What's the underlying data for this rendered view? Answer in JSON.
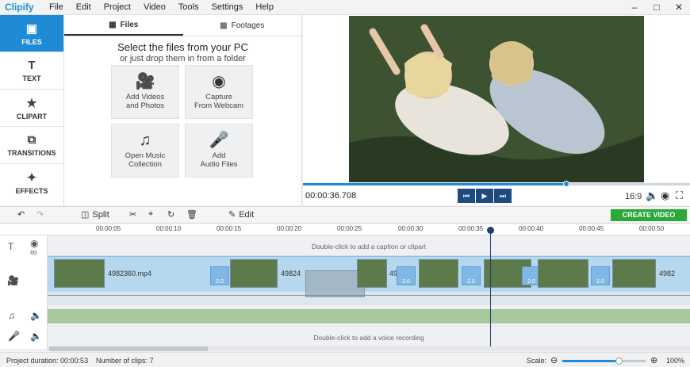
{
  "app": {
    "name": "Clipify"
  },
  "menu": [
    "File",
    "Edit",
    "Project",
    "Video",
    "Tools",
    "Settings",
    "Help"
  ],
  "sidebar": [
    {
      "label": "FILES",
      "icon": "folder-icon",
      "active": true
    },
    {
      "label": "TEXT",
      "icon": "text-icon",
      "active": false
    },
    {
      "label": "CLIPART",
      "icon": "star-icon",
      "active": false
    },
    {
      "label": "TRANSITIONS",
      "icon": "transitions-icon",
      "active": false
    },
    {
      "label": "EFFECTS",
      "icon": "magic-wand-icon",
      "active": false
    }
  ],
  "panel": {
    "tabs": [
      "Files",
      "Footages"
    ],
    "title": "Select the files from your PC",
    "subtitle": "or just drop them in from a folder",
    "tiles": [
      {
        "label1": "Add Videos",
        "label2": "and Photos",
        "icon": "film-camera-icon"
      },
      {
        "label1": "Capture",
        "label2": "From Webcam",
        "icon": "webcam-icon"
      },
      {
        "label1": "Open Music",
        "label2": "Collection",
        "icon": "music-notes-icon"
      },
      {
        "label1": "Add",
        "label2": "Audio Files",
        "icon": "microphone-icon"
      }
    ]
  },
  "preview": {
    "timecode": "00:00:36.708",
    "ratio": "16:9",
    "progress": 0.68
  },
  "toolbar": {
    "split": "Split",
    "edit": "Edit",
    "create": "CREATE VIDEO"
  },
  "ruler": [
    "00:00:05",
    "00:00:10",
    "00:00:15",
    "00:00:20",
    "00:00:25",
    "00:00:30",
    "00:00:35",
    "00:00:40",
    "00:00:45",
    "00:00:50"
  ],
  "timeline": {
    "caption_hint": "Double-click to add a caption or clipart",
    "voice_hint": "Double-click to add a voice recording",
    "clips": [
      {
        "name": "4982360.mp4"
      },
      {
        "name": "49824"
      },
      {
        "name": "49"
      },
      {
        "name": "4982"
      }
    ],
    "transition_label": "2.0"
  },
  "status": {
    "duration": "Project duration: 00:00:53",
    "clips": "Number of clips: 7",
    "scale_label": "Scale:",
    "zoom": "100%",
    "zoom_level": 0.68
  },
  "colors": {
    "accent": "#1f8ad6",
    "create": "#2aa838"
  }
}
